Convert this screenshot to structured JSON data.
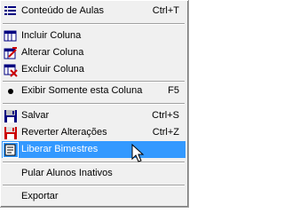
{
  "menu": {
    "items": [
      {
        "label": "Conteúdo de Aulas",
        "shortcut": "Ctrl+T",
        "icon": "list-icon"
      },
      {
        "label": "Incluir Coluna",
        "shortcut": "",
        "icon": "add-column-icon"
      },
      {
        "label": "Alterar Coluna",
        "shortcut": "",
        "icon": "edit-column-icon"
      },
      {
        "label": "Excluir Coluna",
        "shortcut": "",
        "icon": "delete-column-icon"
      },
      {
        "label": "Exibir Somente esta Coluna",
        "shortcut": "F5",
        "icon": "bullet-icon"
      },
      {
        "label": "Salvar",
        "shortcut": "Ctrl+S",
        "icon": "save-icon"
      },
      {
        "label": "Reverter Alterações",
        "shortcut": "Ctrl+Z",
        "icon": "revert-icon"
      },
      {
        "label": "Liberar Bimestres",
        "shortcut": "",
        "icon": "release-icon"
      },
      {
        "label": "Pular Alunos Inativos",
        "shortcut": "",
        "icon": ""
      },
      {
        "label": "Exportar",
        "shortcut": "",
        "icon": ""
      }
    ],
    "selected_label": "Liberar Bimestres"
  },
  "colors": {
    "menu_background": "#f0f0f0",
    "highlight": "#3399ff",
    "highlight_text": "#ffffff"
  }
}
